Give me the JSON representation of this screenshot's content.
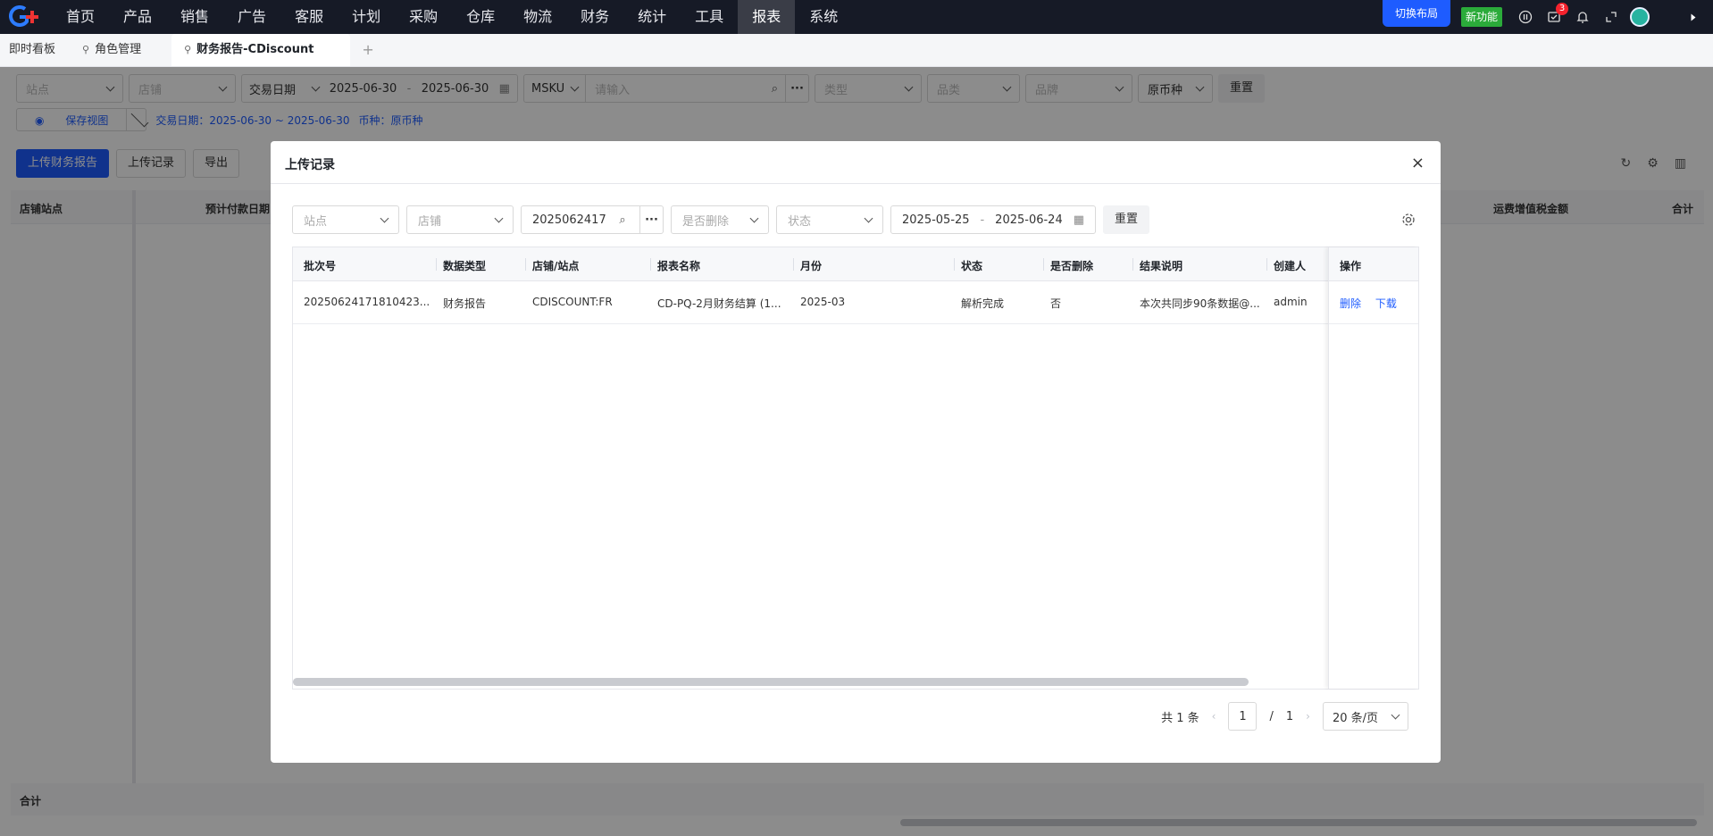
{
  "topnav": {
    "items": [
      "首页",
      "产品",
      "销售",
      "广告",
      "客服",
      "计划",
      "采购",
      "仓库",
      "物流",
      "财务",
      "统计",
      "工具",
      "报表",
      "系统"
    ],
    "active_index": 12,
    "switch_layout": "切换布局",
    "new_feature": "新功能",
    "message_count": "3",
    "icons": [
      "pause-icon",
      "message-icon",
      "bell-icon",
      "fullscreen-icon",
      "avatar",
      "caret-icon"
    ]
  },
  "tabs": {
    "items": [
      "即时看板",
      "角色管理",
      "财务报告-CDiscount"
    ],
    "add": "+"
  },
  "page": {
    "filters": {
      "site": "站点",
      "shop": "店铺",
      "date_type": "交易日期",
      "date_start": "2025-06-30",
      "date_sep": "-",
      "date_end": "2025-06-30",
      "msku": "MSKU",
      "input_placeholder": "请输入",
      "type": "类型",
      "category": "品类",
      "brand": "品牌",
      "currency": "原币种",
      "reset": "重置"
    },
    "save_view": "保存视图",
    "tag_date": "交易日期：2025-06-30 ~ 2025-06-30",
    "tag_currency": "币种：原币种",
    "buttons": {
      "upload": "上传财务报告",
      "records": "上传记录",
      "export": "导出"
    },
    "table_head": {
      "c1": "店铺站点",
      "c2": "预计付款日期",
      "c3": "运费增值税金额",
      "c4": "合计"
    },
    "footer_label": "合计"
  },
  "modal": {
    "title": "上传记录",
    "close": "×",
    "filters": {
      "site": "站点",
      "shop": "店铺",
      "batch_value": "2025062417",
      "deleted": "是否删除",
      "status": "状态",
      "date_start": "2025-05-25",
      "date_sep": "-",
      "date_end": "2025-06-24",
      "reset": "重置"
    },
    "columns": [
      "批次号",
      "数据类型",
      "店铺/站点",
      "报表名称",
      "月份",
      "状态",
      "是否删除",
      "结果说明",
      "创建人",
      "操作"
    ],
    "rows": [
      {
        "batch": "20250624171810423...",
        "data_type": "财务报告",
        "shop_site": "CDISCOUNT:FR",
        "report_name": "CD-PQ-2月财务结算 (1...",
        "month": "2025-03",
        "status": "解析完成",
        "deleted": "否",
        "result": "本次共同步90条数据@...",
        "creator": "admin",
        "op_delete": "删除",
        "op_download": "下载"
      }
    ],
    "pagination": {
      "total": "共 1 条",
      "prev": "‹",
      "current": "1",
      "slash": "/",
      "pages": "1",
      "next": "›",
      "page_size": "20 条/页"
    }
  },
  "colors": {
    "brand": "#1e5cff",
    "nav_bg": "#161a26",
    "new_feature": "#2bab3a",
    "badge": "#f5222d"
  }
}
